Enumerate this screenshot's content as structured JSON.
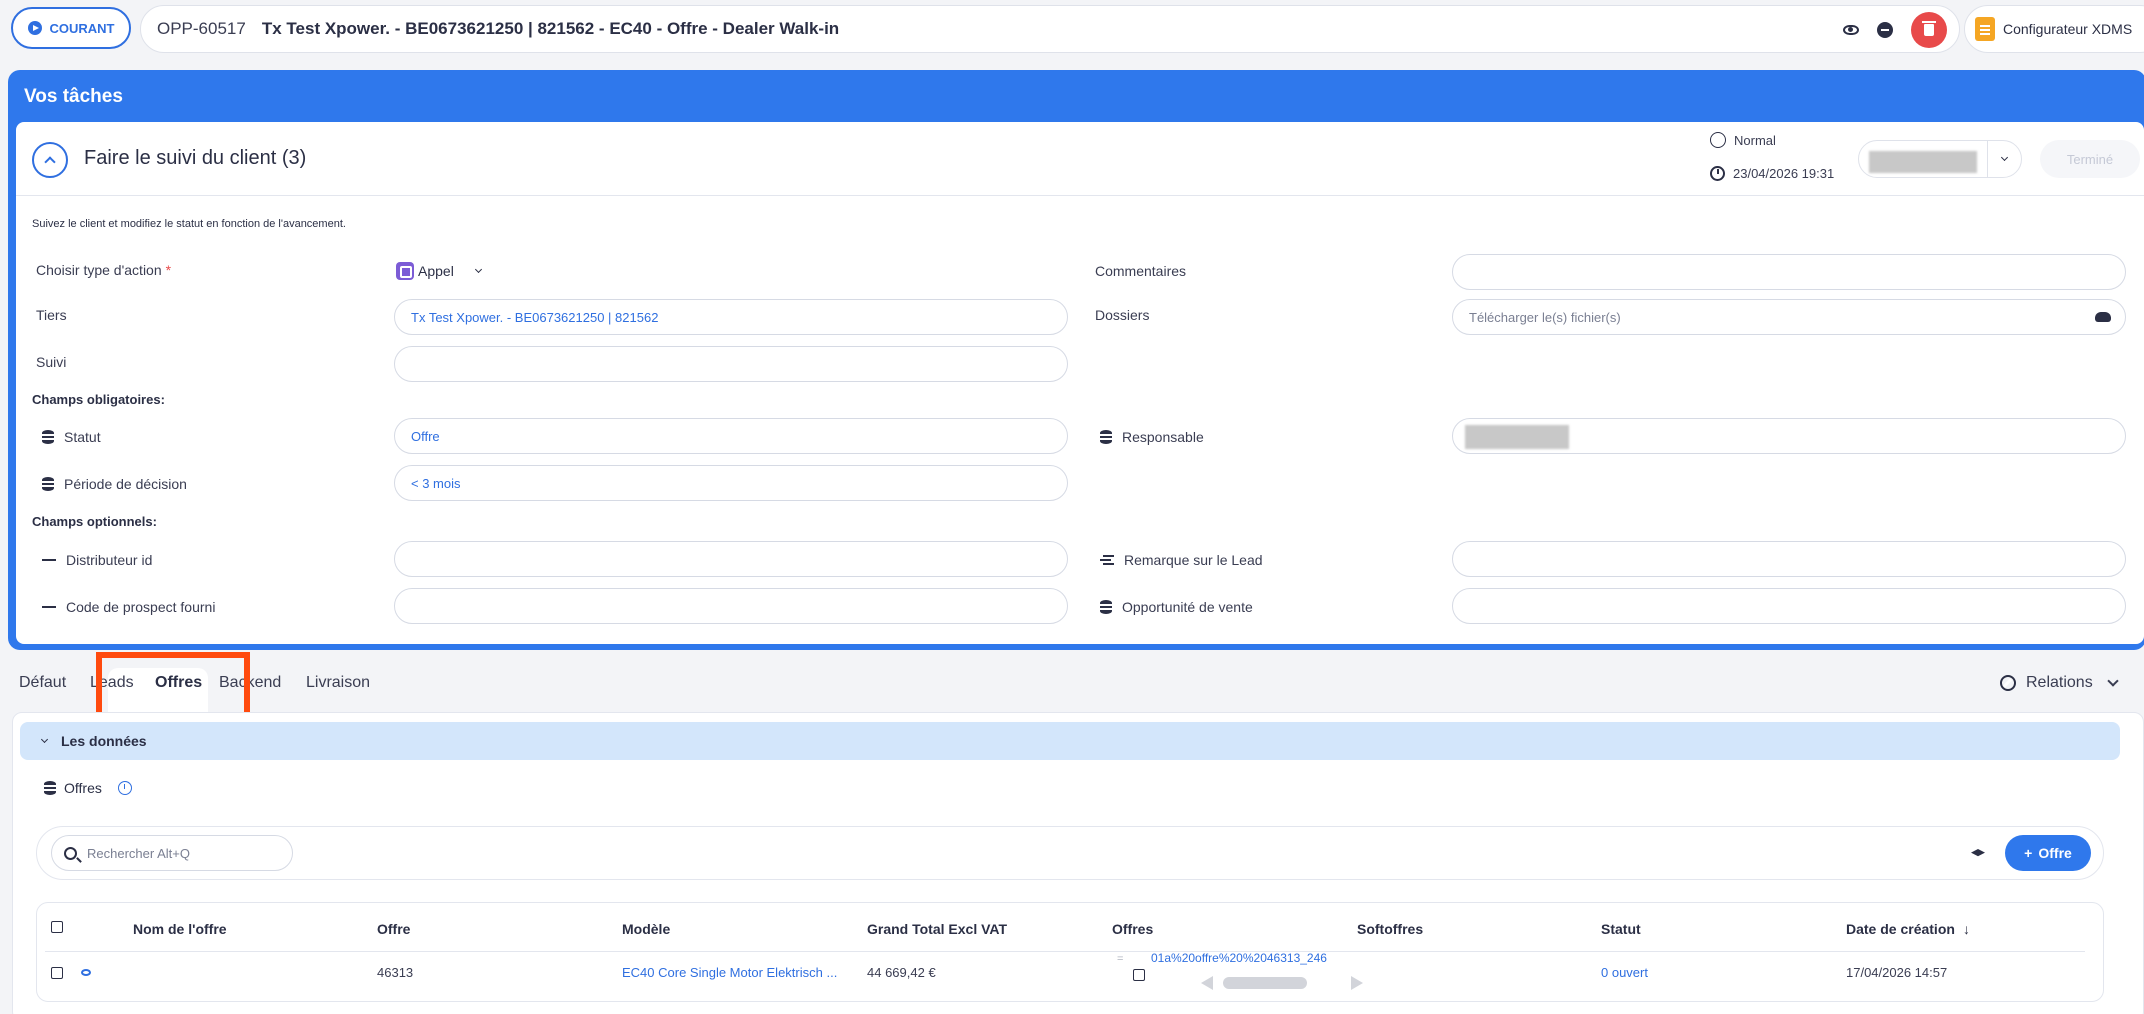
{
  "topbar": {
    "status": "COURANT",
    "opp_id": "OPP-60517",
    "title": "Tx Test Xpower. - BE0673621250 | 821562 - EC40 - Offre - Dealer Walk-in",
    "configurator": "Configurateur XDMS"
  },
  "tasks": {
    "header": "Vos tâches",
    "task_title": "Faire le suivi du client (3)",
    "priority": "Normal",
    "date": "23/04/2026 19:31",
    "done_label": "Terminé",
    "hint": "Suivez le client et modifiez le statut en fonction de l'avancement.",
    "fields": {
      "action_type_label": "Choisir type d'action",
      "action_type_value": "Appel",
      "tiers_label": "Tiers",
      "tiers_value": "Tx Test Xpower. - BE0673621250 | 821562",
      "suivi_label": "Suivi",
      "mandatory_section": "Champs obligatoires:",
      "statut_label": "Statut",
      "statut_value": "Offre",
      "periode_label": "Période de décision",
      "periode_value": "< 3 mois",
      "optional_section": "Champs optionnels:",
      "distributeur_label": "Distributeur id",
      "code_label": "Code de prospect fourni",
      "commentaires_label": "Commentaires",
      "dossiers_label": "Dossiers",
      "dossiers_placeholder": "Télécharger le(s) fichier(s)",
      "responsable_label": "Responsable",
      "remarque_label": "Remarque sur le Lead",
      "opportunite_label": "Opportunité de vente"
    }
  },
  "tabs": [
    "Défaut",
    "Leads",
    "Offres",
    "Backend",
    "Livraison"
  ],
  "active_tab": "Offres",
  "relations": "Relations",
  "data_section": "Les données",
  "offres_title": "Offres",
  "search_placeholder": "Rechercher Alt+Q",
  "add_button": "Offre",
  "table": {
    "columns": [
      "Nom de l'offre",
      "Offre",
      "Modèle",
      "Grand Total Excl VAT",
      "Offres",
      "Softoffres",
      "Statut",
      "Date de création"
    ],
    "row": {
      "offre": "46313",
      "modele": "EC40 Core Single Motor Elektrisch ...",
      "total": "44 669,42 €",
      "offres_file": "01a%20offre%20%2046313_246",
      "statut": "0 ouvert",
      "date": "17/04/2026 14:57"
    }
  },
  "colors": {
    "accent": "#2f78ec",
    "danger": "#e84a4a",
    "highlight": "#ff4a0e"
  }
}
